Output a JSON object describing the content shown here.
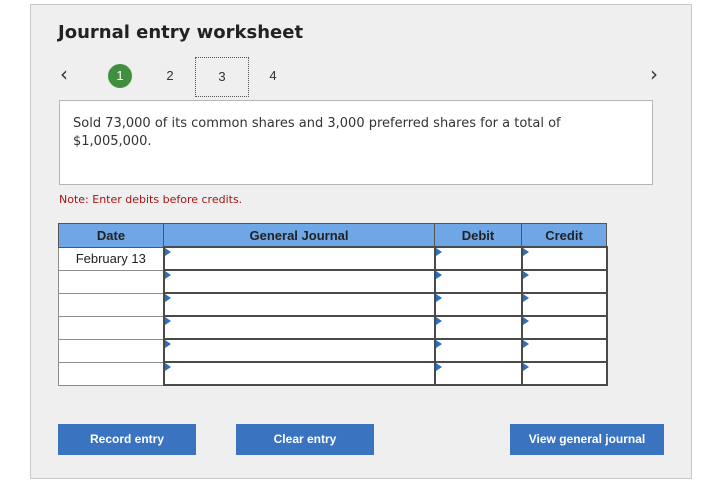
{
  "title": "Journal entry worksheet",
  "nav": {
    "prev_icon": "chevron-left-icon",
    "next_icon": "chevron-right-icon"
  },
  "steps": [
    "1",
    "2",
    "3",
    "4"
  ],
  "description": "Sold 73,000 of its common shares and 3,000 preferred shares for a total of $1,005,000.",
  "note": "Note: Enter debits before credits.",
  "table": {
    "headers": {
      "date": "Date",
      "journal": "General Journal",
      "debit": "Debit",
      "credit": "Credit"
    },
    "rows": [
      {
        "date": "February 13",
        "account": "",
        "debit": "",
        "credit": ""
      },
      {
        "date": "",
        "account": "",
        "debit": "",
        "credit": ""
      },
      {
        "date": "",
        "account": "",
        "debit": "",
        "credit": ""
      },
      {
        "date": "",
        "account": "",
        "debit": "",
        "credit": ""
      },
      {
        "date": "",
        "account": "",
        "debit": "",
        "credit": ""
      },
      {
        "date": "",
        "account": "",
        "debit": "",
        "credit": ""
      }
    ]
  },
  "buttons": {
    "record": "Record entry",
    "clear": "Clear entry",
    "view": "View general journal"
  },
  "colors": {
    "accent": "#3a73c0",
    "header": "#6fa7e6",
    "step_done": "#3f8f3f",
    "note": "#a31515"
  }
}
